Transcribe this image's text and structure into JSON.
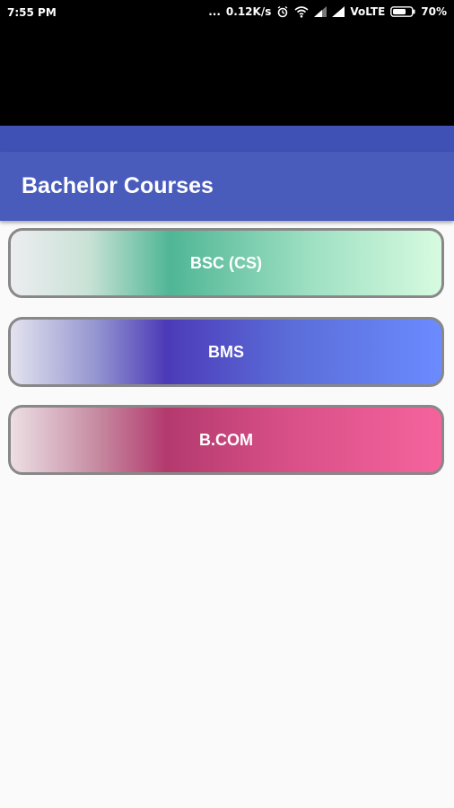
{
  "status_bar": {
    "time": "7:55 PM",
    "dots": "...",
    "speed": "0.12K/s",
    "network": "VoLTE",
    "battery": "70%"
  },
  "app_bar": {
    "title": "Bachelor Courses"
  },
  "courses": [
    {
      "label": "BSC (CS)"
    },
    {
      "label": "BMS"
    },
    {
      "label": "B.COM"
    }
  ],
  "colors": {
    "primary": "#4a5cbb",
    "primary_dark": "#3f51b5",
    "background": "#fafafa",
    "button_border": "#888888"
  }
}
